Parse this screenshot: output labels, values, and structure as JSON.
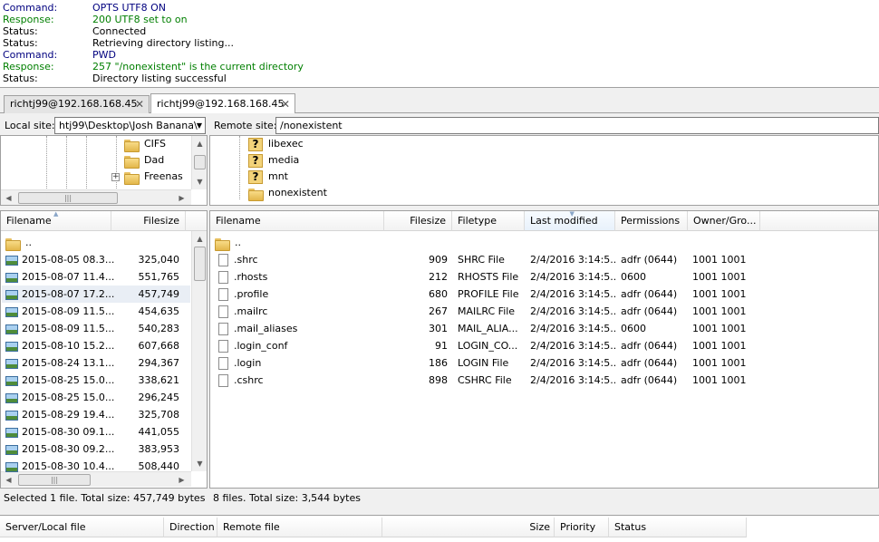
{
  "log": [
    {
      "kind": "Command:",
      "text": "OPTS UTF8 ON",
      "color": "#00007f"
    },
    {
      "kind": "Response:",
      "text": "200 UTF8 set to on",
      "color": "#007f00"
    },
    {
      "kind": "Status:",
      "text": "Connected",
      "color": "#000000"
    },
    {
      "kind": "Status:",
      "text": "Retrieving directory listing...",
      "color": "#000000"
    },
    {
      "kind": "Command:",
      "text": "PWD",
      "color": "#00007f"
    },
    {
      "kind": "Response:",
      "text": "257 \"/nonexistent\" is the current directory",
      "color": "#007f00"
    },
    {
      "kind": "Status:",
      "text": "Directory listing successful",
      "color": "#000000"
    }
  ],
  "tabs": [
    {
      "label": "richtj99@192.168.168.45",
      "close": "✕",
      "active": false
    },
    {
      "label": "richtj99@192.168.168.45",
      "close": "✕",
      "active": true
    }
  ],
  "local": {
    "label": "Local site:",
    "path": "htj99\\Desktop\\Josh Banana\\",
    "tree": [
      {
        "name": "CIFS"
      },
      {
        "name": "Dad"
      },
      {
        "name": "Freenas"
      }
    ],
    "columns": {
      "filename": "Filename",
      "filesize": "Filesize"
    },
    "parent": "..",
    "files": [
      {
        "name": "2015-08-05 08.3...",
        "size": "325,040",
        "selected": false
      },
      {
        "name": "2015-08-07 11.4...",
        "size": "551,765",
        "selected": false
      },
      {
        "name": "2015-08-07 17.2...",
        "size": "457,749",
        "selected": true
      },
      {
        "name": "2015-08-09 11.5...",
        "size": "454,635",
        "selected": false
      },
      {
        "name": "2015-08-09 11.5...",
        "size": "540,283",
        "selected": false
      },
      {
        "name": "2015-08-10 15.2...",
        "size": "607,668",
        "selected": false
      },
      {
        "name": "2015-08-24 13.1...",
        "size": "294,367",
        "selected": false
      },
      {
        "name": "2015-08-25 15.0...",
        "size": "338,621",
        "selected": false
      },
      {
        "name": "2015-08-25 15.0...",
        "size": "296,245",
        "selected": false
      },
      {
        "name": "2015-08-29 19.4...",
        "size": "325,708",
        "selected": false
      },
      {
        "name": "2015-08-30 09.1...",
        "size": "441,055",
        "selected": false
      },
      {
        "name": "2015-08-30 09.2...",
        "size": "383,953",
        "selected": false
      },
      {
        "name": "2015-08-30 10.4...",
        "size": "508,440",
        "selected": false
      }
    ],
    "status": "Selected 1 file. Total size: 457,749 bytes"
  },
  "remote": {
    "label": "Remote site:",
    "path": "/nonexistent",
    "tree": [
      {
        "name": "libexec",
        "icon": "unknown-folder"
      },
      {
        "name": "media",
        "icon": "unknown-folder"
      },
      {
        "name": "mnt",
        "icon": "unknown-folder"
      },
      {
        "name": "nonexistent",
        "icon": "folder"
      }
    ],
    "columns": {
      "filename": "Filename",
      "filesize": "Filesize",
      "filetype": "Filetype",
      "modified": "Last modified",
      "permissions": "Permissions",
      "owner": "Owner/Gro..."
    },
    "parent": "..",
    "files": [
      {
        "name": ".shrc",
        "size": "909",
        "type": "SHRC File",
        "modified": "2/4/2016 3:14:5...",
        "perm": "adfr (0644)",
        "owner": "1001 1001"
      },
      {
        "name": ".rhosts",
        "size": "212",
        "type": "RHOSTS File",
        "modified": "2/4/2016 3:14:5...",
        "perm": "0600",
        "owner": "1001 1001"
      },
      {
        "name": ".profile",
        "size": "680",
        "type": "PROFILE File",
        "modified": "2/4/2016 3:14:5...",
        "perm": "adfr (0644)",
        "owner": "1001 1001"
      },
      {
        "name": ".mailrc",
        "size": "267",
        "type": "MAILRC File",
        "modified": "2/4/2016 3:14:5...",
        "perm": "adfr (0644)",
        "owner": "1001 1001"
      },
      {
        "name": ".mail_aliases",
        "size": "301",
        "type": "MAIL_ALIA...",
        "modified": "2/4/2016 3:14:5...",
        "perm": "0600",
        "owner": "1001 1001"
      },
      {
        "name": ".login_conf",
        "size": "91",
        "type": "LOGIN_CO...",
        "modified": "2/4/2016 3:14:5...",
        "perm": "adfr (0644)",
        "owner": "1001 1001"
      },
      {
        "name": ".login",
        "size": "186",
        "type": "LOGIN File",
        "modified": "2/4/2016 3:14:5...",
        "perm": "adfr (0644)",
        "owner": "1001 1001"
      },
      {
        "name": ".cshrc",
        "size": "898",
        "type": "CSHRC File",
        "modified": "2/4/2016 3:14:5...",
        "perm": "adfr (0644)",
        "owner": "1001 1001"
      }
    ],
    "status": "8 files. Total size: 3,544 bytes"
  },
  "queue": {
    "columns": [
      "Server/Local file",
      "Direction",
      "Remote file",
      "Size",
      "Priority",
      "Status"
    ]
  }
}
